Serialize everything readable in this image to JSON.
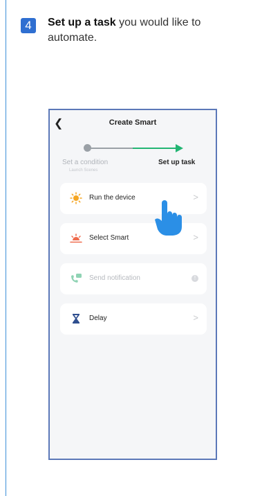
{
  "step": {
    "number": "4",
    "instruction_bold": "Set up a task",
    "instruction_rest": " you would like to automate."
  },
  "screen": {
    "title": "Create Smart",
    "progress": {
      "step1_label": "Set a condition",
      "step1_sub": "Launch Scenes",
      "step2_label": "Set up task"
    },
    "options": [
      {
        "label": "Run the device",
        "icon": "sun-icon",
        "chevron": ">"
      },
      {
        "label": "Select Smart",
        "icon": "sunrise-icon",
        "chevron": ">"
      },
      {
        "label": "Send notification",
        "icon": "notification-icon",
        "chevron": "!"
      },
      {
        "label": "Delay",
        "icon": "hourglass-icon",
        "chevron": ">"
      }
    ]
  },
  "colors": {
    "accent_blue": "#2f6fd1",
    "progress_green": "#22b573",
    "frame": "#5b78b8"
  }
}
